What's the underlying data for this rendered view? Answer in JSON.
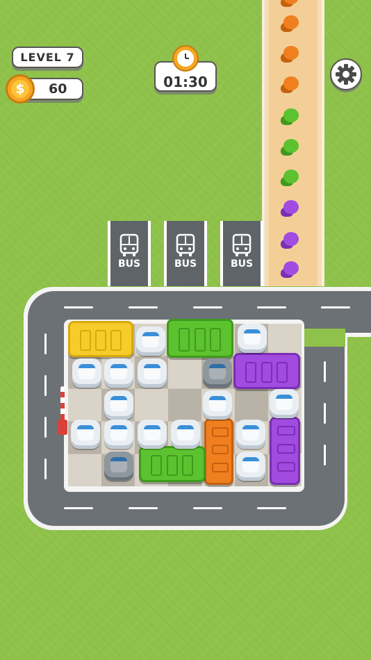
{
  "hud": {
    "level_label": "LEVEL 7",
    "coins": "60",
    "coin_icon": "dollar-coin-icon",
    "timer": "01:30",
    "timer_icon": "clock-icon",
    "settings_icon": "gear-icon"
  },
  "bus_bays": [
    {
      "label": "BUS",
      "icon": "bus-icon"
    },
    {
      "label": "BUS",
      "icon": "bus-icon"
    },
    {
      "label": "BUS",
      "icon": "bus-icon"
    }
  ],
  "queue_colors": [
    "orange",
    "orange",
    "orange",
    "orange",
    "green",
    "green",
    "green",
    "purple",
    "purple",
    "purple"
  ],
  "colors": {
    "grass": "#8fc24a",
    "orange": "#f07f1f",
    "green": "#5cc22f",
    "purple": "#a24be0",
    "yellow": "#f6cc2a",
    "road": "#6c7176"
  },
  "parking_lot": {
    "vehicles": [
      {
        "kind": "bus",
        "color": "yellow",
        "orientation": "horizontal"
      },
      {
        "kind": "bus",
        "color": "green",
        "orientation": "horizontal"
      },
      {
        "kind": "bus",
        "color": "purple",
        "orientation": "horizontal"
      },
      {
        "kind": "bus",
        "color": "orange",
        "orientation": "vertical"
      },
      {
        "kind": "bus",
        "color": "purple",
        "orientation": "vertical"
      },
      {
        "kind": "bus",
        "color": "green",
        "orientation": "horizontal"
      }
    ],
    "car_count": 17
  }
}
